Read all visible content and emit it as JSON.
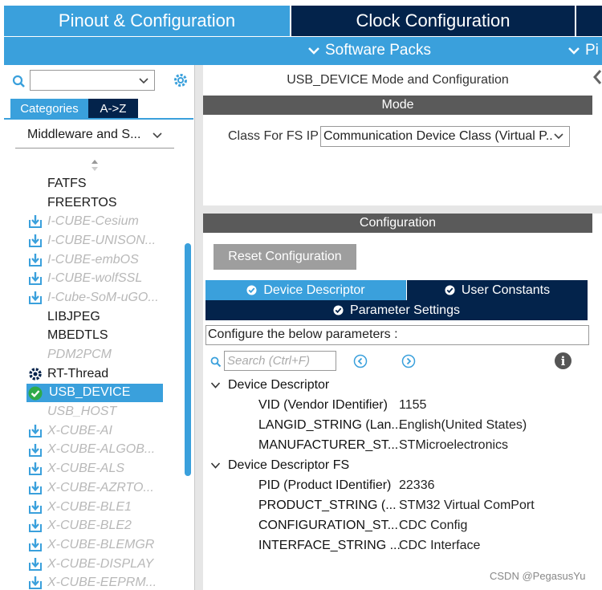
{
  "top_tabs": {
    "pinout": "Pinout & Configuration",
    "clock": "Clock Configuration"
  },
  "subbar": {
    "software_packs": "Software Packs",
    "pinout_partial": "Pi"
  },
  "left": {
    "category_tab": "Categories",
    "az_tab": "A->Z",
    "middleware_select": "Middleware and S...",
    "items": [
      {
        "label": "FATFS",
        "style": "normal",
        "icon": "none"
      },
      {
        "label": "FREERTOS",
        "style": "normal",
        "icon": "none"
      },
      {
        "label": "I-CUBE-Cesium",
        "style": "dim",
        "icon": "download-icon"
      },
      {
        "label": "I-CUBE-UNISON...",
        "style": "dim",
        "icon": "download-icon"
      },
      {
        "label": "I-CUBE-embOS",
        "style": "dim",
        "icon": "download-icon"
      },
      {
        "label": "I-CUBE-wolfSSL",
        "style": "dim",
        "icon": "download-icon"
      },
      {
        "label": "I-Cube-SoM-uGO...",
        "style": "dim",
        "icon": "download-icon"
      },
      {
        "label": "LIBJPEG",
        "style": "normal",
        "icon": "none"
      },
      {
        "label": "MBEDTLS",
        "style": "normal",
        "icon": "none"
      },
      {
        "label": "PDM2PCM",
        "style": "dim",
        "icon": "none"
      },
      {
        "label": "RT-Thread",
        "style": "normal",
        "icon": "gear-icon"
      },
      {
        "label": "USB_DEVICE",
        "style": "selected",
        "icon": "check-icon"
      },
      {
        "label": "USB_HOST",
        "style": "dim",
        "icon": "none"
      },
      {
        "label": "X-CUBE-AI",
        "style": "dim",
        "icon": "download-icon"
      },
      {
        "label": "X-CUBE-ALGOB...",
        "style": "dim",
        "icon": "download-icon"
      },
      {
        "label": "X-CUBE-ALS",
        "style": "dim",
        "icon": "download-icon"
      },
      {
        "label": "X-CUBE-AZRTO...",
        "style": "dim",
        "icon": "download-icon"
      },
      {
        "label": "X-CUBE-BLE1",
        "style": "dim",
        "icon": "download-icon"
      },
      {
        "label": "X-CUBE-BLE2",
        "style": "dim",
        "icon": "download-icon"
      },
      {
        "label": "X-CUBE-BLEMGR",
        "style": "dim",
        "icon": "download-icon"
      },
      {
        "label": "X-CUBE-DISPLAY",
        "style": "dim",
        "icon": "download-icon"
      },
      {
        "label": "X-CUBE-EEPRM...",
        "style": "dim",
        "icon": "download-icon"
      }
    ]
  },
  "mode": {
    "title": "USB_DEVICE Mode and Configuration",
    "bar": "Mode",
    "class_label": "Class For FS IP",
    "class_value": "Communication Device Class (Virtual P..."
  },
  "config": {
    "bar": "Configuration",
    "reset_button": "Reset Configuration",
    "tabs": {
      "device_descriptor": "Device Descriptor",
      "user_constants": "User Constants",
      "parameter_settings": "Parameter Settings"
    },
    "hint": "Configure the below parameters :",
    "search_placeholder": "Search (Ctrl+F)",
    "groups": [
      {
        "title": "Device Descriptor",
        "rows": [
          {
            "name": "VID (Vendor IDentifier)",
            "value": "1155"
          },
          {
            "name": "LANGID_STRING (Lan...",
            "value": "English(United States)"
          },
          {
            "name": "MANUFACTURER_ST...",
            "value": "STMicroelectronics"
          }
        ]
      },
      {
        "title": "Device Descriptor FS",
        "rows": [
          {
            "name": "PID (Product IDentifier)",
            "value": "22336"
          },
          {
            "name": "PRODUCT_STRING (...",
            "value": "STM32 Virtual ComPort"
          },
          {
            "name": "CONFIGURATION_ST...",
            "value": "CDC Config"
          },
          {
            "name": "INTERFACE_STRING ...",
            "value": "CDC Interface"
          }
        ]
      }
    ]
  },
  "watermark": "CSDN @PegasusYu",
  "colors": {
    "accent": "#3aa0dc",
    "dark_navy": "#03234b",
    "gray_bar": "#5a5a5a"
  }
}
